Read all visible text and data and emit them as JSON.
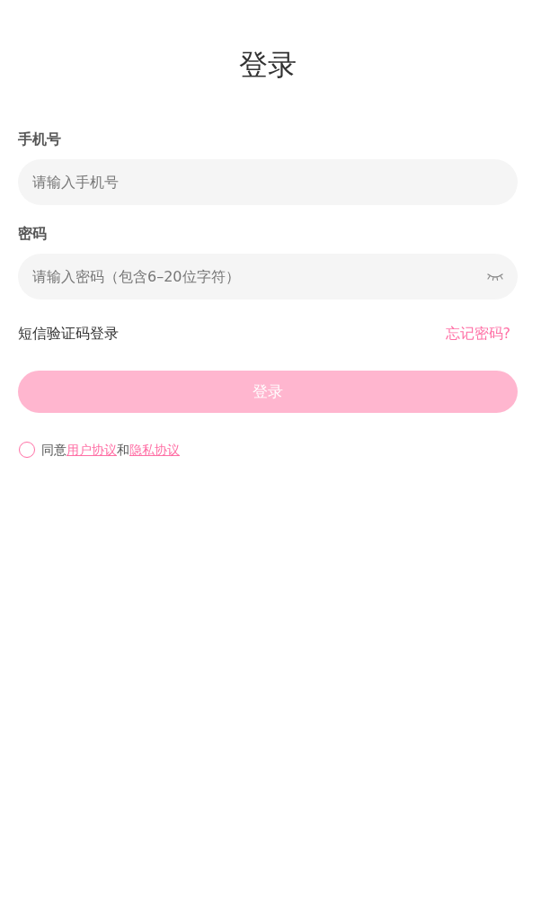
{
  "title": "登录",
  "phone": {
    "label": "手机号",
    "placeholder": "请输入手机号"
  },
  "password": {
    "label": "密码",
    "placeholder": "请输入密码（包含6–20位字符）",
    "visible": false
  },
  "links": [
    {
      "text": "短信验证码登录",
      "kind": "plain"
    },
    {
      "text": "忘记密码?",
      "kind": "accent"
    }
  ],
  "login_button": {
    "label": "登录",
    "disabled": true
  },
  "agreement": {
    "checked": false,
    "parts": [
      {
        "kind": "text",
        "text": "同意"
      },
      {
        "kind": "link",
        "text": "用户协议"
      },
      {
        "kind": "text",
        "text": "和"
      },
      {
        "kind": "link",
        "text": "隐私协议"
      }
    ]
  }
}
